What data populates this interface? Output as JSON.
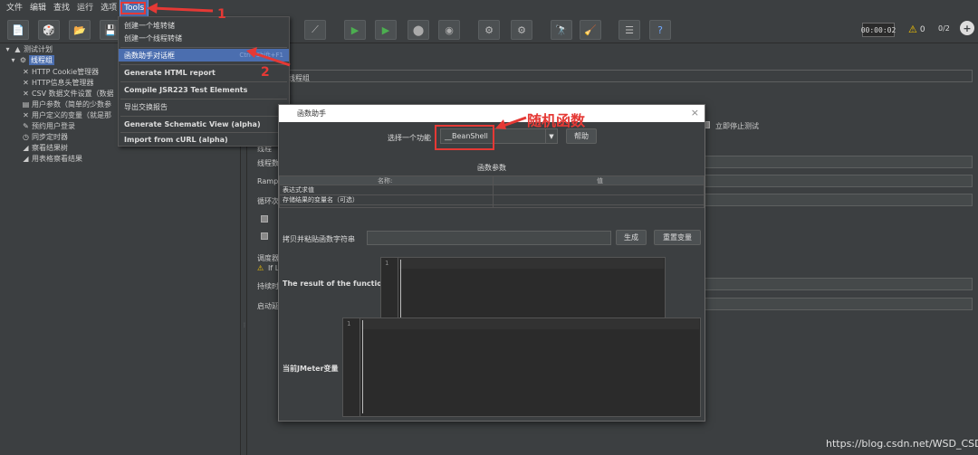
{
  "menubar": {
    "items": [
      "文件",
      "编辑",
      "查找",
      "运行",
      "选项",
      "Tools"
    ],
    "active_index": 5
  },
  "toolbar": {
    "timer": "00:00:02",
    "warning_count": "0",
    "thread_count": "0/2"
  },
  "tree": {
    "nodes": [
      "测试计划",
      "线程组",
      "HTTP Cookie管理器",
      "HTTP信息头管理器",
      "CSV 数据文件设置（数据",
      "用户参数（简单的少数参",
      "用户定义的变量（就是那",
      "预约用户登录",
      "同步定时器",
      "察看结果树",
      "用表格察看结果"
    ]
  },
  "dropdown": {
    "items": [
      {
        "label": "创建一个堆转储",
        "shortcut": ""
      },
      {
        "label": "创建一个线程转储",
        "shortcut": ""
      },
      {
        "label": "函数助手对话框",
        "shortcut": "Ctrl+Shift+F1"
      },
      {
        "label": "Generate HTML report",
        "shortcut": ""
      },
      {
        "label": "Compile JSR223 Test Elements",
        "shortcut": ""
      },
      {
        "label": "导出交换报告",
        "shortcut": ""
      },
      {
        "label": "Generate Schematic View (alpha)",
        "shortcut": ""
      },
      {
        "label": "Import from cURL (alpha)",
        "shortcut": ""
      }
    ],
    "selected_index": 2
  },
  "right_panel": {
    "title": "线程组",
    "stop_test_label": "立即停止测试",
    "labels": [
      "线程",
      "线程数",
      "Ramp",
      "循环次",
      "调度器",
      "持续时",
      "启动延"
    ],
    "warning_text": "If L"
  },
  "dialog": {
    "title": "函数助手",
    "select_label": "选择一个功能",
    "selected_function": "__BeanShell",
    "help_button": "帮助",
    "params_title": "函数参数",
    "col_name": "名称:",
    "col_value": "值",
    "rows": [
      "表达式求值",
      "存储结果的变量名（可选）"
    ],
    "copy_label": "拷贝并粘贴函数字符串",
    "generate_button": "生成",
    "reset_button": "重置变量",
    "result_label": "The result of the function is",
    "result_line": "1",
    "jmeter_vars_label": "当前JMeter变量",
    "vars_line": "1"
  },
  "annotations": {
    "label_1": "1",
    "label_2": "2",
    "label_random": "随机函数"
  },
  "watermark": "https://blog.csdn.net/WSD_CSDN",
  "colors": {
    "background": "#3c3f41",
    "selection": "#4b6eaf",
    "annotation_red": "#e53935"
  }
}
